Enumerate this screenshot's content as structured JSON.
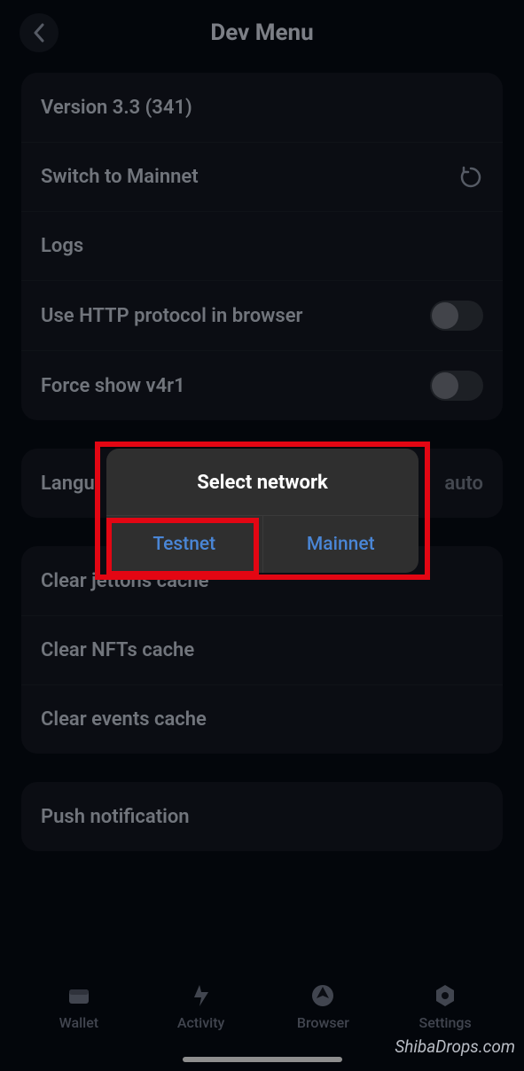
{
  "header": {
    "title": "Dev Menu"
  },
  "section1": {
    "version": "Version 3.3 (341)",
    "switch": "Switch to Mainnet",
    "logs": "Logs",
    "http": "Use HTTP protocol in browser",
    "force": "Force show v4r1"
  },
  "section2": {
    "lang_label": "Langu",
    "lang_value": "auto"
  },
  "section3": {
    "clear_jettons": "Clear jettons cache",
    "clear_nfts": "Clear NFTs cache",
    "clear_events": "Clear events cache"
  },
  "section4": {
    "push": "Push notification"
  },
  "modal": {
    "title": "Select network",
    "testnet": "Testnet",
    "mainnet": "Mainnet"
  },
  "tabs": {
    "wallet": "Wallet",
    "activity": "Activity",
    "browser": "Browser",
    "settings": "Settings"
  },
  "watermark": "ShibaDrops.com"
}
